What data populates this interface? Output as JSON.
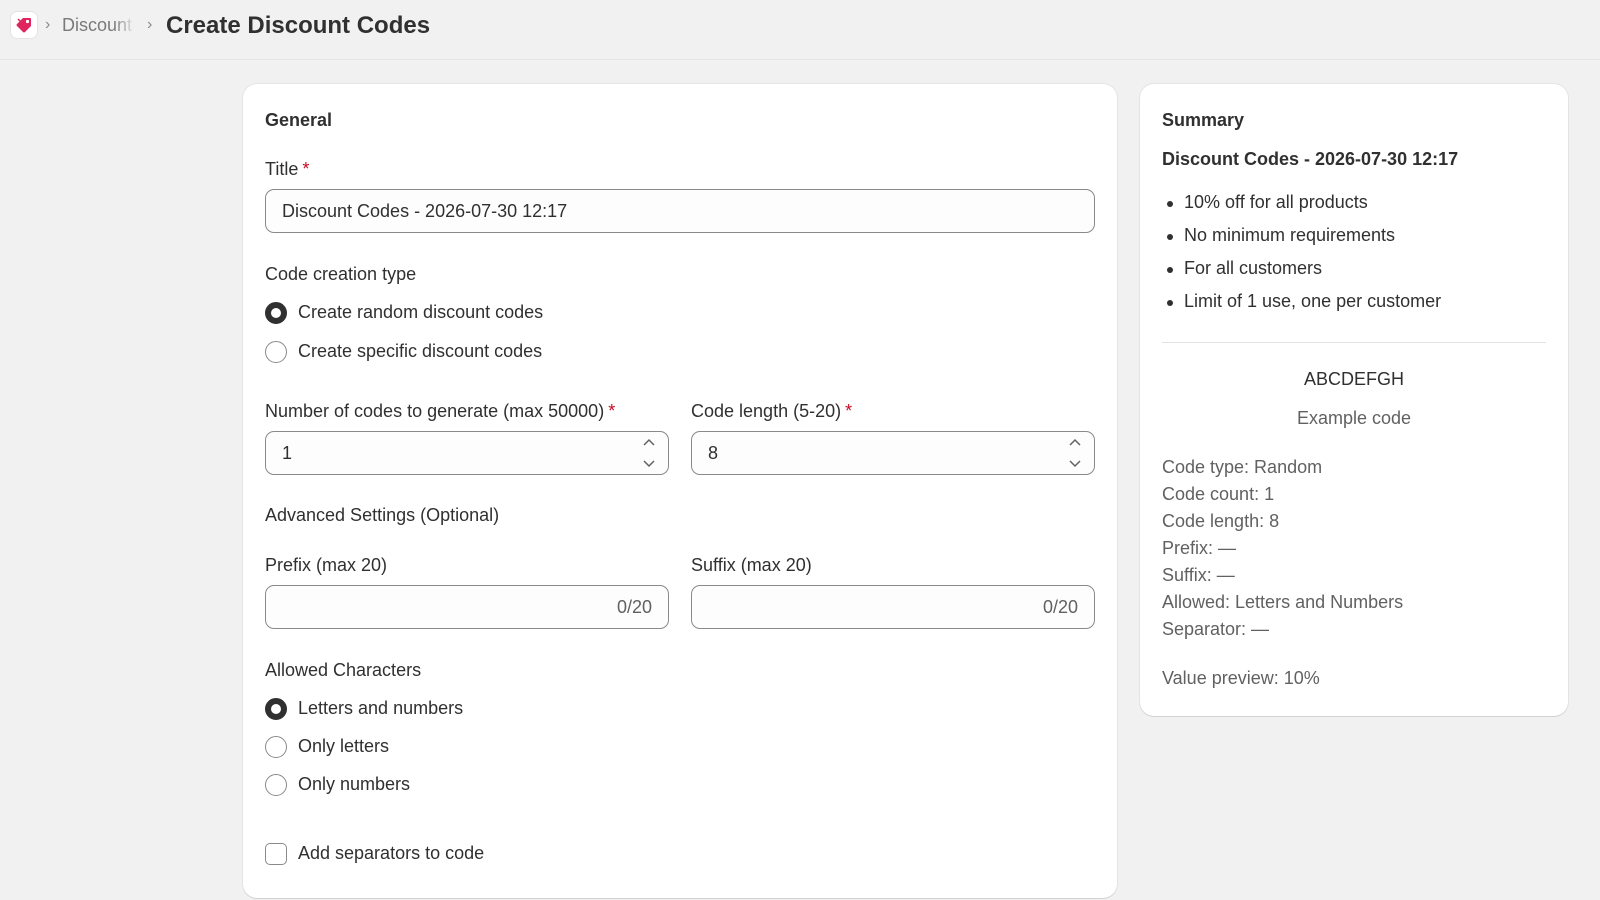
{
  "header": {
    "breadcrumb_parent": "Discount Codes",
    "page_title": "Create Discount Codes"
  },
  "colors": {
    "required_asterisk": "#c70a24",
    "app_icon": "#e0245e"
  },
  "general": {
    "section_title": "General",
    "title_label": "Title",
    "title_value": "Discount Codes - 2026-07-30 12:17",
    "required_mark": "*",
    "code_creation_type_label": "Code creation type",
    "code_creation_options": [
      {
        "label": "Create random discount codes",
        "selected": true
      },
      {
        "label": "Create specific discount codes",
        "selected": false
      }
    ],
    "num_codes_label": "Number of codes to generate (max 50000)",
    "num_codes_value": "1",
    "code_length_label": "Code length (5-20)",
    "code_length_value": "8",
    "advanced_label": "Advanced Settings (Optional)",
    "prefix_label": "Prefix (max 20)",
    "prefix_value": "",
    "prefix_counter": "0/20",
    "suffix_label": "Suffix (max 20)",
    "suffix_value": "",
    "suffix_counter": "0/20",
    "allowed_chars_label": "Allowed Characters",
    "allowed_chars_options": [
      {
        "label": "Letters and numbers",
        "selected": true
      },
      {
        "label": "Only letters",
        "selected": false
      },
      {
        "label": "Only numbers",
        "selected": false
      }
    ],
    "separators_label": "Add separators to code",
    "separators_checked": false
  },
  "summary": {
    "title": "Summary",
    "discount_title": "Discount Codes - 2026-07-30 12:17",
    "bullets": [
      "10% off for all products",
      "No minimum requirements",
      "For all customers",
      "Limit of 1 use, one per customer"
    ],
    "example_code": "ABCDEFGH",
    "example_caption": "Example code",
    "details": [
      "Code type: Random",
      "Code count: 1",
      "Code length: 8",
      "Prefix: —",
      "Suffix: —",
      "Allowed: Letters and Numbers",
      "Separator: —"
    ],
    "value_preview": "Value preview: 10%"
  }
}
